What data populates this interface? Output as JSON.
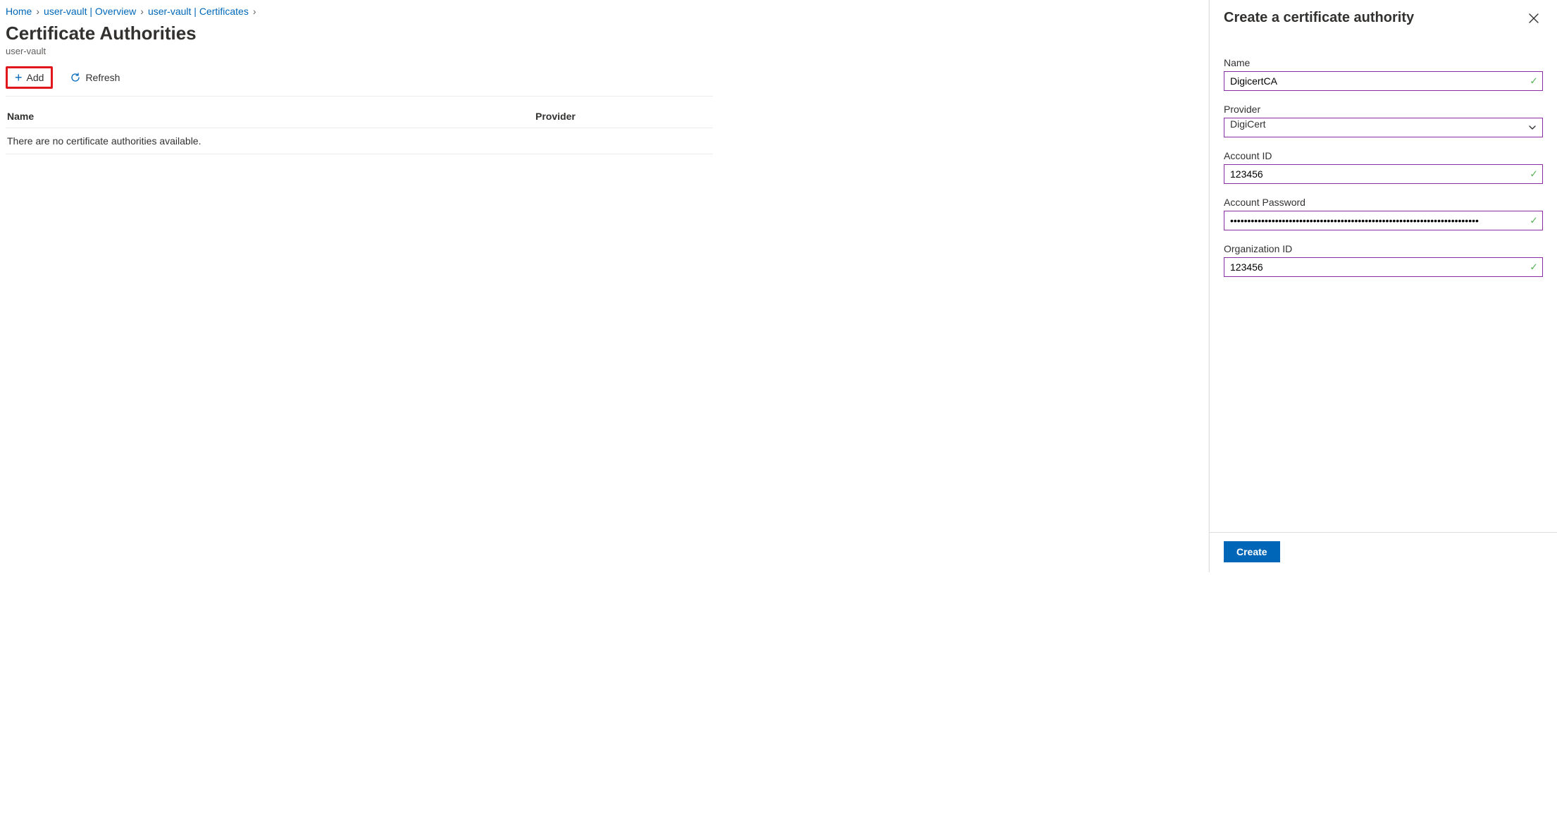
{
  "breadcrumbs": {
    "items": [
      {
        "label": "Home"
      },
      {
        "label": "user-vault | Overview"
      },
      {
        "label": "user-vault | Certificates"
      }
    ]
  },
  "page": {
    "title": "Certificate Authorities",
    "subtitle": "user-vault"
  },
  "toolbar": {
    "add_label": "Add",
    "refresh_label": "Refresh"
  },
  "table": {
    "col_name_header": "Name",
    "col_provider_header": "Provider",
    "empty_message": "There are no certificate authorities available."
  },
  "blade": {
    "title": "Create a certificate authority",
    "name": {
      "label": "Name",
      "value": "DigicertCA"
    },
    "provider": {
      "label": "Provider",
      "value": "DigiCert"
    },
    "account_id": {
      "label": "Account ID",
      "value": "123456"
    },
    "account_password": {
      "label": "Account Password",
      "value": "••••••••••••••••••••••••••••••••••••••••••••••••••••••••••••••••••••••••"
    },
    "organization_id": {
      "label": "Organization ID",
      "value": "123456"
    },
    "create_label": "Create"
  }
}
